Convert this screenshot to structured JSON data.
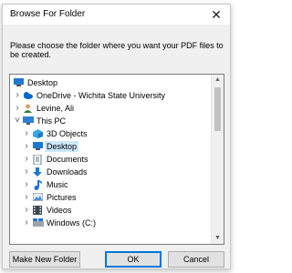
{
  "window": {
    "title": "Browse For Folder",
    "close_glyph": "✕"
  },
  "prompt": "Please choose the folder where you want your PDF files to be created.",
  "tree": {
    "items": [
      {
        "label": "Desktop",
        "chev": "",
        "icon": "desktop-icon"
      },
      {
        "label": "OneDrive - Wichita State University",
        "chev": "›",
        "icon": "onedrive-icon"
      },
      {
        "label": "Levine, Ali",
        "chev": "›",
        "icon": "user-icon"
      },
      {
        "label": "This PC",
        "chev": "˅",
        "icon": "pc-icon"
      },
      {
        "label": "3D Objects",
        "chev": "›",
        "icon": "3d-objects-icon"
      },
      {
        "label": "Desktop",
        "chev": "›",
        "icon": "desktop-icon",
        "selected": true
      },
      {
        "label": "Documents",
        "chev": "›",
        "icon": "documents-icon"
      },
      {
        "label": "Downloads",
        "chev": "›",
        "icon": "downloads-icon"
      },
      {
        "label": "Music",
        "chev": "›",
        "icon": "music-icon"
      },
      {
        "label": "Pictures",
        "chev": "›",
        "icon": "pictures-icon"
      },
      {
        "label": "Videos",
        "chev": "›",
        "icon": "videos-icon"
      },
      {
        "label": "Windows (C:)",
        "chev": "›",
        "icon": "drive-icon"
      }
    ],
    "scroll_up": "▲",
    "scroll_down": "▼"
  },
  "buttons": {
    "new_folder": "Make New Folder",
    "ok": "OK",
    "cancel": "Cancel"
  },
  "colors": {
    "selection": "#cce8ff",
    "default_button_border": "#0078d7"
  }
}
